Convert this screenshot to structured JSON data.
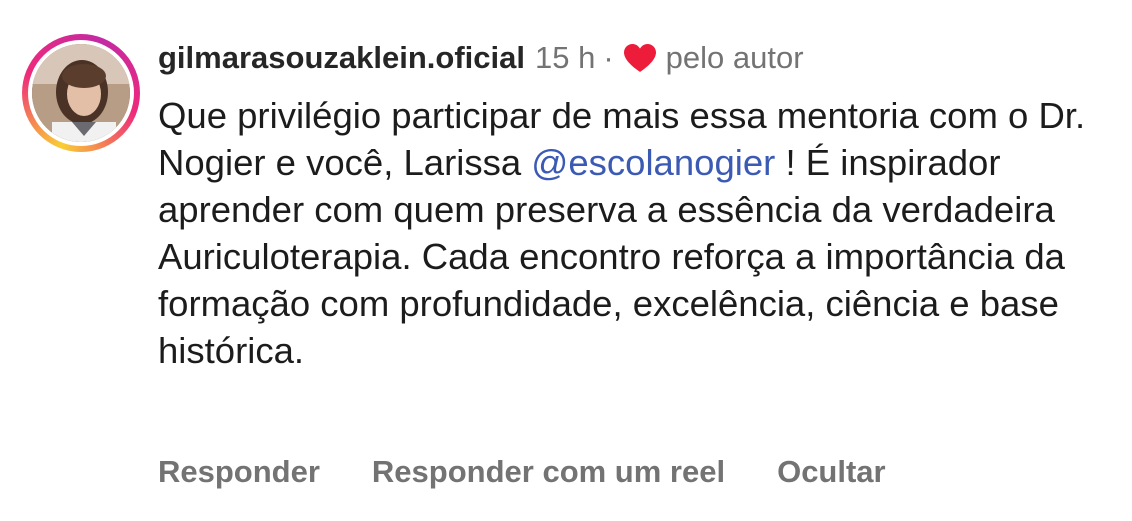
{
  "comment": {
    "username": "gilmarasouzaklein.oficial",
    "time": "15 h",
    "separator": "·",
    "liked_by_author_label": "pelo autor",
    "text_before_mention": "Que privilégio participar de mais essa mentoria com o Dr. Nogier e você, Larissa ",
    "mention": "@escolanogier",
    "text_after_mention": " ! É inspirador aprender com quem preserva a essência da verdadeira Auriculoterapia. Cada encontro reforça a importância da formação com profundidade, excelência, ciência e base histórica.",
    "actions": {
      "reply": "Responder",
      "reply_reel": "Responder com um reel",
      "hide": "Ocultar"
    },
    "icons": {
      "heart": "heart-icon",
      "avatar": "profile-avatar"
    },
    "colors": {
      "heart": "#ed1c3b",
      "mention": "#3b5ab3",
      "meta": "#737373",
      "username": "#262626"
    }
  }
}
